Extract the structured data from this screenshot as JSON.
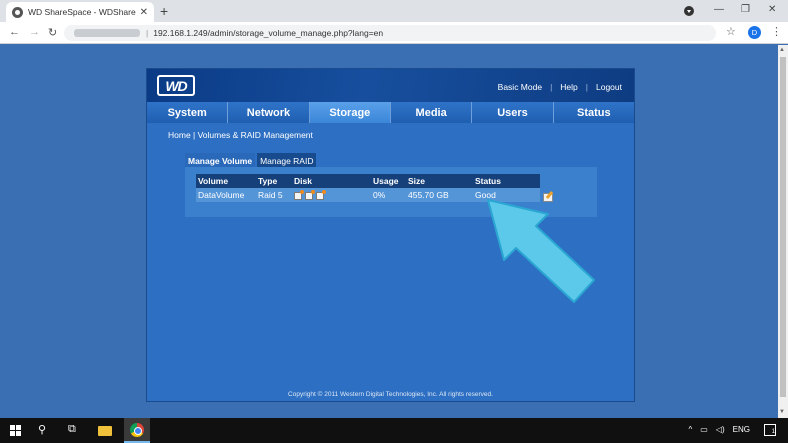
{
  "browser": {
    "tab_title": "WD ShareSpace - WDShareSpace",
    "tab_close": "✕",
    "new_tab": "+",
    "url": "192.168.1.249/admin/storage_volume_manage.php?lang=en",
    "profile_initial": "D",
    "icons": [
      "back-icon",
      "forward-icon",
      "reload-icon",
      "star-icon",
      "menu-icon"
    ]
  },
  "app": {
    "logo": "WD",
    "header_links": [
      "Basic Mode",
      "Help",
      "Logout"
    ],
    "nav": [
      {
        "label": "System",
        "active": false
      },
      {
        "label": "Network",
        "active": false
      },
      {
        "label": "Storage",
        "active": true
      },
      {
        "label": "Media",
        "active": false
      },
      {
        "label": "Users",
        "active": false
      },
      {
        "label": "Status",
        "active": false
      }
    ],
    "breadcrumb": "Home | Volumes & RAID Management",
    "subtabs": [
      {
        "label": "Manage Volume",
        "active": true
      },
      {
        "label": "Manage RAID",
        "active": false
      }
    ],
    "table": {
      "headers": [
        "Volume",
        "Type",
        "Disk",
        "Usage",
        "Size",
        "Status"
      ],
      "rows": [
        {
          "volume": "DataVolume",
          "type": "Raid 5",
          "disks": 3,
          "usage": "0%",
          "size": "455.70 GB",
          "status": "Good"
        }
      ]
    },
    "footer": "Copyright © 2011 Western Digital Technologies, Inc. All rights reserved."
  },
  "annotation": {
    "color": "#5cc8ea",
    "target": "status-good"
  },
  "taskbar": {
    "language": "ENG",
    "notification_count": "1",
    "icons": [
      "windows-start-icon",
      "search-icon",
      "task-view-icon",
      "file-explorer-icon",
      "chrome-icon"
    ]
  }
}
